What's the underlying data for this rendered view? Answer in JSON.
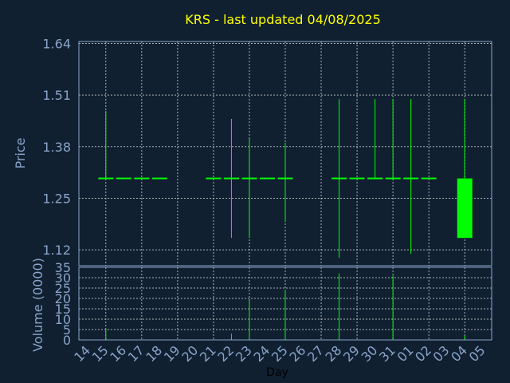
{
  "title": "KRS - last updated 04/08/2025",
  "colors": {
    "background": "#102031",
    "title": "#ffff00",
    "axis_text": "#8aa4c8",
    "candle": "#00ff00",
    "grid": "#c8c8c8"
  },
  "chart_data": [
    {
      "type": "candlestick",
      "ylabel": "Price",
      "ylim": [
        1.08,
        1.645
      ],
      "yticks": [
        "1.64",
        "1.51",
        "1.38",
        "1.25",
        "1.12"
      ],
      "grid": true,
      "series": [
        {
          "x": "15",
          "open": 1.3,
          "high": 1.47,
          "low": 1.3,
          "close": 1.3
        },
        {
          "x": "16",
          "open": 1.3,
          "high": 1.3,
          "low": 1.3,
          "close": 1.3
        },
        {
          "x": "17",
          "open": 1.3,
          "high": 1.3,
          "low": 1.3,
          "close": 1.3
        },
        {
          "x": "18",
          "open": 1.3,
          "high": 1.3,
          "low": 1.3,
          "close": 1.3
        },
        {
          "x": "21",
          "open": 1.3,
          "high": 1.3,
          "low": 1.3,
          "close": 1.3
        },
        {
          "x": "22",
          "open": 1.3,
          "high": 1.45,
          "low": 1.15,
          "close": 1.3
        },
        {
          "x": "23",
          "open": 1.3,
          "high": 1.4,
          "low": 1.15,
          "close": 1.3
        },
        {
          "x": "24",
          "open": 1.3,
          "high": 1.3,
          "low": 1.3,
          "close": 1.3
        },
        {
          "x": "25",
          "open": 1.3,
          "high": 1.39,
          "low": 1.19,
          "close": 1.3
        },
        {
          "x": "28",
          "open": 1.3,
          "high": 1.5,
          "low": 1.1,
          "close": 1.3
        },
        {
          "x": "29",
          "open": 1.3,
          "high": 1.3,
          "low": 1.3,
          "close": 1.3
        },
        {
          "x": "30",
          "open": 1.3,
          "high": 1.5,
          "low": 1.3,
          "close": 1.3
        },
        {
          "x": "31",
          "open": 1.3,
          "high": 1.5,
          "low": 1.3,
          "close": 1.3
        },
        {
          "x": "01",
          "open": 1.3,
          "high": 1.5,
          "low": 1.11,
          "close": 1.3
        },
        {
          "x": "02",
          "open": 1.3,
          "high": 1.3,
          "low": 1.3,
          "close": 1.3
        },
        {
          "x": "04",
          "open": 1.3,
          "high": 1.5,
          "low": 1.15,
          "close": 1.15
        }
      ]
    },
    {
      "type": "bar",
      "xlabel": "Day",
      "ylabel": "Volume (0000)",
      "ylim": [
        0,
        35
      ],
      "yticks": [
        "35",
        "30",
        "25",
        "20",
        "15",
        "10",
        "5",
        "0"
      ],
      "grid": true,
      "categories": [
        "14",
        "15",
        "16",
        "17",
        "18",
        "19",
        "20",
        "21",
        "22",
        "23",
        "24",
        "25",
        "26",
        "27",
        "28",
        "29",
        "30",
        "31",
        "01",
        "02",
        "03",
        "04",
        "05"
      ],
      "values": [
        0,
        5,
        0,
        0,
        0,
        0,
        0,
        0,
        3,
        19,
        0,
        24,
        0,
        0,
        32,
        0,
        0,
        31,
        0,
        0,
        0,
        2,
        0
      ]
    }
  ]
}
